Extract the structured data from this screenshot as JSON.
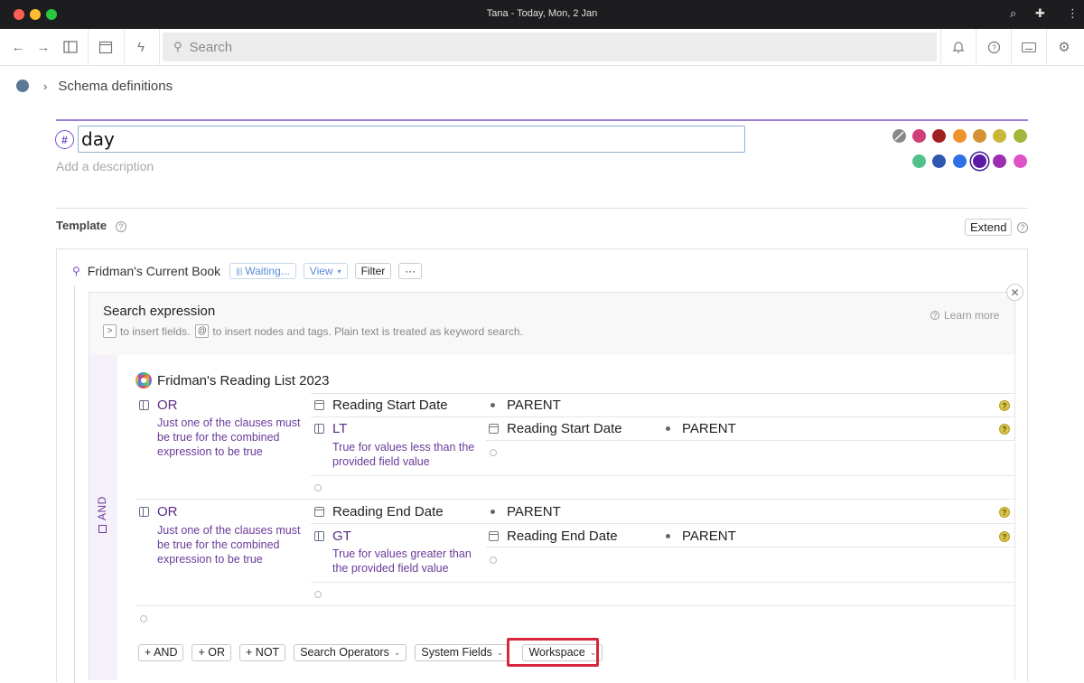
{
  "window": {
    "title": "Tana - Today, Mon, 2 Jan"
  },
  "toolbar": {
    "search_placeholder": "Search",
    "calendar_day": "2"
  },
  "breadcrumb": {
    "label": "Schema definitions"
  },
  "supertag": {
    "name": "day",
    "description_placeholder": "Add a description",
    "colors_row1": [
      "#d03d79",
      "#a0201f",
      "#f0922c",
      "#d49435",
      "#c9b838",
      "#a0b83c"
    ],
    "colors_row2": [
      "#52c08a",
      "#2f58b0",
      "#2f6fe8",
      "#5a1aa6",
      "#9a2fb0",
      "#e052c8"
    ]
  },
  "template": {
    "label": "Template",
    "extend_label": "Extend"
  },
  "search_node": {
    "title": "Fridman's Current Book",
    "waiting_label": "Waiting...",
    "view_label": "View",
    "filter_label": "Filter",
    "more_label": "···"
  },
  "search_expression": {
    "title": "Search expression",
    "hint_gt": ">",
    "hint_part1": "to insert fields.",
    "hint_at": "@",
    "hint_part2": "to insert nodes and tags. Plain text is treated as keyword search.",
    "learn_more": "Learn more",
    "and_label": "AND",
    "reading_list": "Fridman's Reading List 2023",
    "or_label": "OR",
    "or_desc": "Just one of the clauses must be true for the combined expression to be true",
    "lt_label": "LT",
    "lt_desc": "True for values less than the provided field value",
    "gt_label": "GT",
    "gt_desc": "True for values greater than the provided field value",
    "start_field": "Reading Start Date",
    "end_field": "Reading End Date",
    "parent": "PARENT"
  },
  "bottom_buttons": {
    "and": "+ AND",
    "or": "+ OR",
    "not": "+ NOT",
    "search_operators": "Search Operators",
    "system_fields": "System Fields",
    "workspace": "Workspace"
  }
}
